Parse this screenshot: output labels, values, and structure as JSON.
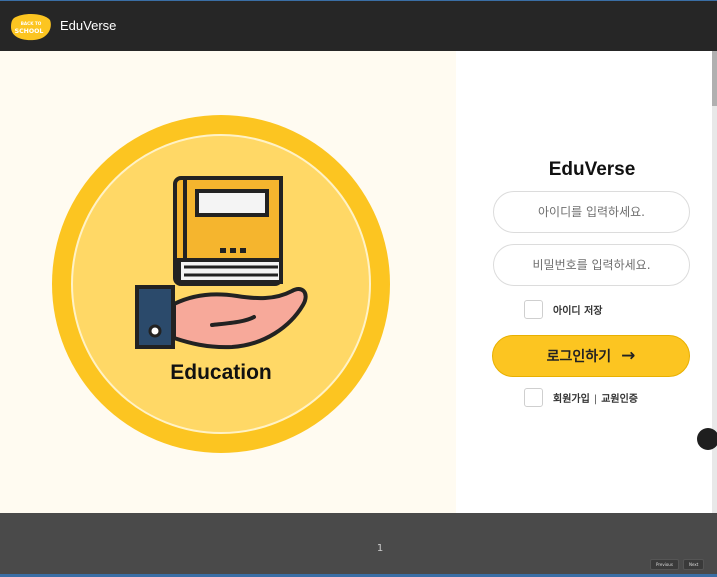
{
  "header": {
    "logo_lines": [
      "BACK TO",
      "SCHOOL"
    ],
    "app_title": "EduVerse"
  },
  "hero": {
    "label": "Education",
    "colors": {
      "outer_ring": "#fcc521",
      "inner_circle": "#ffd866",
      "book": "#f5b52e",
      "hand": "#f7a99a",
      "sleeve": "#2b4a6b"
    }
  },
  "login": {
    "title": "EduVerse",
    "id_placeholder": "아이디를 입력하세요.",
    "password_placeholder": "비밀번호를 입력하세요.",
    "remember_label": "아이디 저장",
    "submit_label": "로그인하기",
    "submit_arrow": "→",
    "signup_label": "회원가입",
    "separator": "|",
    "teacher_auth_label": "교원인증",
    "accent_color": "#fcc521"
  },
  "footer": {
    "page_number": "1",
    "prev_label": "Previous",
    "next_label": "Next"
  }
}
